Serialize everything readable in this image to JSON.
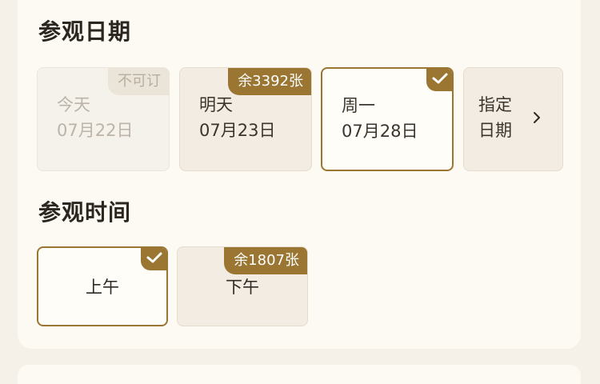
{
  "visit_date": {
    "title": "参观日期",
    "options": [
      {
        "line1": "今天",
        "line2": "07月22日",
        "badge": "不可订",
        "state": "disabled"
      },
      {
        "line1": "明天",
        "line2": "07月23日",
        "badge": "余3392张",
        "state": "available"
      },
      {
        "line1": "周一",
        "line2": "07月28日",
        "badge": "",
        "state": "selected"
      },
      {
        "line1": "指定",
        "line2": "日期",
        "badge": "",
        "state": "picker"
      }
    ]
  },
  "visit_time": {
    "title": "参观时间",
    "options": [
      {
        "label": "上午",
        "badge": "",
        "state": "selected"
      },
      {
        "label": "下午",
        "badge": "余1807张",
        "state": "available"
      }
    ]
  },
  "colors": {
    "accent": "#9a7632",
    "card_bg": "#f3ece2",
    "page_bg": "#f6f1e8"
  },
  "icons": {
    "selected": "checkmark-icon",
    "picker": "chevron-right-icon"
  }
}
